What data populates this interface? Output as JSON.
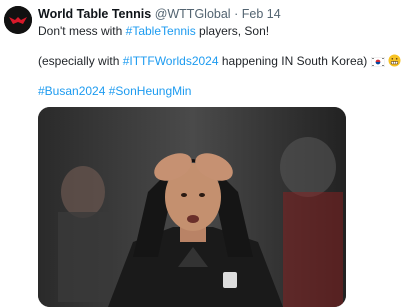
{
  "tweet": {
    "author": "World Table Tennis",
    "handle": "@WTTGlobal",
    "separator": "·",
    "date": "Feb 14",
    "line1": {
      "prefix": "Don't mess with ",
      "hashtag": "#TableTennis",
      "suffix": " players, Son!"
    },
    "line2": {
      "prefix": "(especially with ",
      "hashtag": "#ITTFWorlds2024",
      "suffix": " happening IN South Korea) "
    },
    "hashtags": [
      "#Busan2024",
      "#SonHeungMin"
    ],
    "emojis": [
      "south-korea-flag",
      "grimacing-face"
    ],
    "media": {
      "description_icon": "photo-of-player-holding-head"
    }
  },
  "colors": {
    "link": "#1d9bf0",
    "text": "#0f1419",
    "muted": "#536471",
    "avatar_bg": "#111111",
    "brand_red": "#d7192a"
  }
}
